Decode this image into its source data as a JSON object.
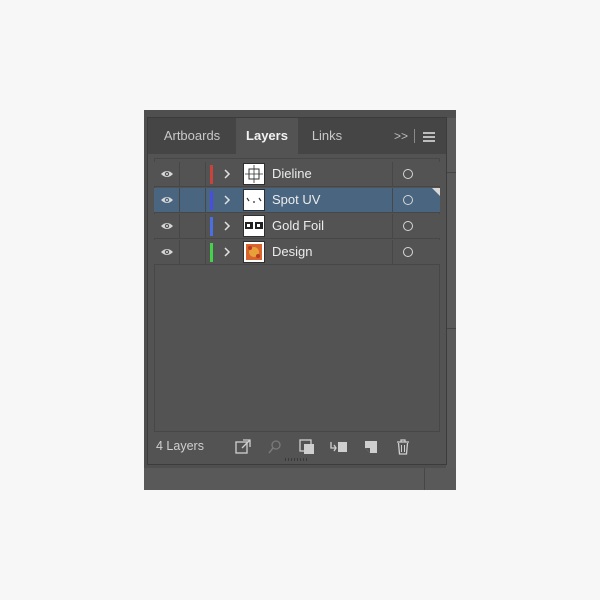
{
  "panel": {
    "tabs": [
      {
        "label": "Artboards",
        "active": false
      },
      {
        "label": "Layers",
        "active": true
      },
      {
        "label": "Links",
        "active": false
      }
    ],
    "overflow_label": ">>",
    "menu_icon": "hamburger-menu-icon"
  },
  "layers": [
    {
      "name": "Dieline",
      "color": "#c8433b",
      "visible": true,
      "selected": false,
      "thumb": "dieline"
    },
    {
      "name": "Spot UV",
      "color": "#4a4ee0",
      "visible": true,
      "selected": true,
      "thumb": "spotuv"
    },
    {
      "name": "Gold Foil",
      "color": "#4b6fe0",
      "visible": true,
      "selected": false,
      "thumb": "goldfoil"
    },
    {
      "name": "Design",
      "color": "#45d24a",
      "visible": true,
      "selected": false,
      "thumb": "design"
    }
  ],
  "footer": {
    "layer_count": "4 Layers",
    "icons": [
      "export-for-screens-icon",
      "locate-object-icon",
      "make-clipping-mask-icon",
      "create-sublayer-icon",
      "create-new-layer-icon",
      "delete-layer-icon"
    ]
  }
}
